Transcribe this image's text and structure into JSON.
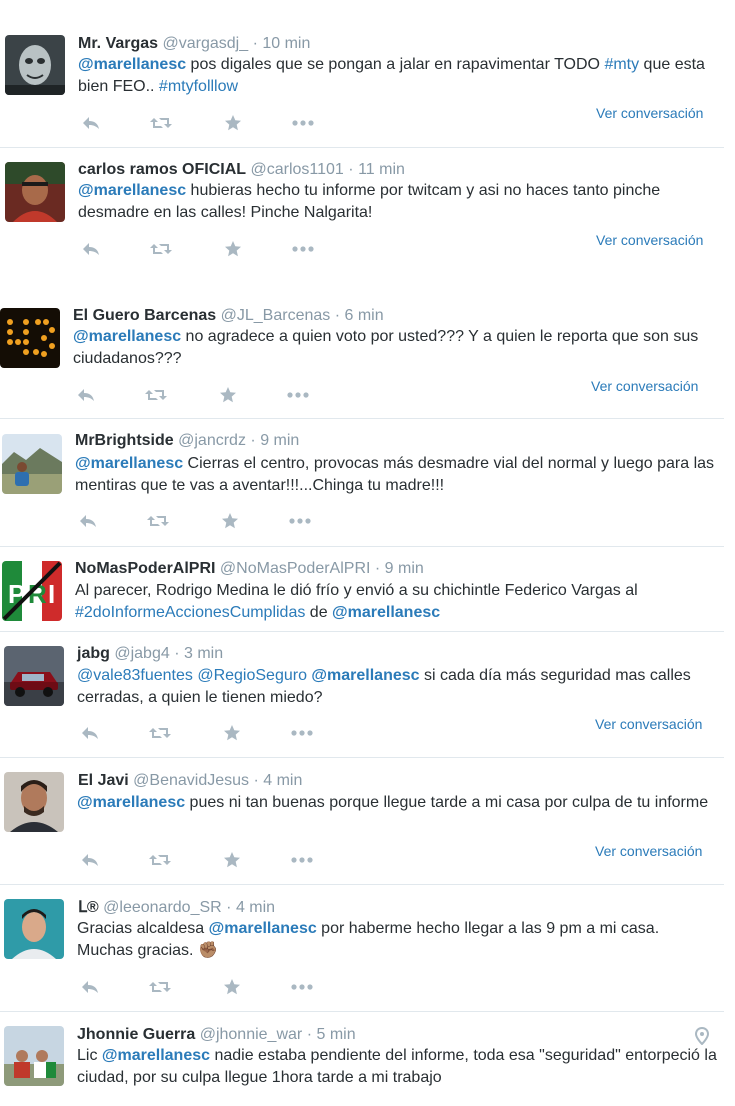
{
  "colors": {
    "link": "#2b7bb9",
    "muted": "#8899a6",
    "icon": "#aab8c2",
    "divider": "#e1e8ed",
    "text": "#292f33"
  },
  "icons": {
    "reply": "reply-icon",
    "retweet": "retweet-icon",
    "favorite": "star-icon",
    "more": "more-icon",
    "location": "location-pin-icon"
  },
  "tweets": [
    {
      "name": "Mr. Vargas",
      "handle": "@vargasdj_",
      "sep": "·",
      "time": "10 min",
      "parts": [
        {
          "t": "@marellanesc",
          "k": "mention"
        },
        {
          "t": " pos digales que se pongan a jalar en rapavimentar TODO ",
          "k": "plain"
        },
        {
          "t": "#mty",
          "k": "hashtag"
        },
        {
          "t": " que esta bien FEO.. ",
          "k": "plain"
        },
        {
          "t": "#mtyfolllow",
          "k": "hashtag"
        }
      ],
      "conversation": "Ver conversación"
    },
    {
      "name": "carlos ramos OFICIAL",
      "handle": "@carlos1101",
      "sep": "·",
      "time": "11 min",
      "parts": [
        {
          "t": "@marellanesc",
          "k": "mention"
        },
        {
          "t": " hubieras hecho tu informe por twitcam y asi no haces tanto pinche desmadre en las calles! Pinche Nalgarita!",
          "k": "plain"
        }
      ],
      "conversation": "Ver conversación"
    },
    {
      "name": "El Guero Barcenas",
      "handle": "@JL_Barcenas",
      "sep": "·",
      "time": "6 min",
      "parts": [
        {
          "t": "@marellanesc",
          "k": "mention"
        },
        {
          "t": " no agradece a quien voto por usted??? Y a quien le reporta que son  sus ciudadanos???",
          "k": "plain"
        }
      ],
      "conversation": "Ver conversación"
    },
    {
      "name": "MrBrightside",
      "handle": "@jancrdz",
      "sep": "·",
      "time": "9 min",
      "parts": [
        {
          "t": "@marellanesc",
          "k": "mention"
        },
        {
          "t": " Cierras el centro, provocas más desmadre vial del normal y luego para las mentiras que te vas a aventar!!!...Chinga tu madre!!!",
          "k": "plain"
        }
      ],
      "conversation": ""
    },
    {
      "name": "NoMasPoderAlPRI",
      "handle": "@NoMasPoderAlPRI",
      "sep": "·",
      "time": "9 min",
      "parts": [
        {
          "t": "Al parecer, Rodrigo Medina le dió frío y envió a su chichintle Federico Vargas al ",
          "k": "plain"
        },
        {
          "t": "#2doInformeAccionesCumplidas",
          "k": "hashtag"
        },
        {
          "t": " de ",
          "k": "plain"
        },
        {
          "t": "@marellanesc",
          "k": "mention"
        }
      ],
      "conversation": ""
    },
    {
      "name": "jabg",
      "handle": "@jabg4",
      "sep": "·",
      "time": "3 min",
      "parts": [
        {
          "t": "@vale83fuentes",
          "k": "mention-light"
        },
        {
          "t": " ",
          "k": "plain"
        },
        {
          "t": "@RegioSeguro",
          "k": "mention-light"
        },
        {
          "t": " ",
          "k": "plain"
        },
        {
          "t": "@marellanesc",
          "k": "mention"
        },
        {
          "t": " si cada día más seguridad mas calles cerradas, a quien le tienen miedo?",
          "k": "plain"
        }
      ],
      "conversation": "Ver conversación"
    },
    {
      "name": "El Javi",
      "handle": "@BenavidJesus",
      "sep": "·",
      "time": "4 min",
      "parts": [
        {
          "t": "@marellanesc",
          "k": "mention"
        },
        {
          "t": " pues ni tan buenas porque llegue tarde a mi casa por culpa de tu informe",
          "k": "plain"
        }
      ],
      "conversation": "Ver conversación"
    },
    {
      "name": "ᒪ®",
      "handle": "@leeonardo_SR",
      "sep": "·",
      "time": "4 min",
      "parts": [
        {
          "t": "Gracias alcaldesa ",
          "k": "plain"
        },
        {
          "t": "@marellanesc",
          "k": "mention"
        },
        {
          "t": "  por haberme hecho llegar a las 9 pm a mi casa. Muchas gracias. ",
          "k": "plain"
        },
        {
          "t": "✊🏽",
          "k": "emoji"
        }
      ],
      "conversation": ""
    },
    {
      "name": "Jhonnie Guerra",
      "handle": "@jhonnie_war",
      "sep": "·",
      "time": "5 min",
      "parts": [
        {
          "t": "Lic ",
          "k": "plain"
        },
        {
          "t": "@marellanesc",
          "k": "mention"
        },
        {
          "t": " nadie estaba pendiente del informe, toda esa \"seguridad\" entorpeció la ciudad, por su culpa llegue 1hora tarde a mi trabajo",
          "k": "plain"
        }
      ],
      "conversation": ""
    }
  ]
}
